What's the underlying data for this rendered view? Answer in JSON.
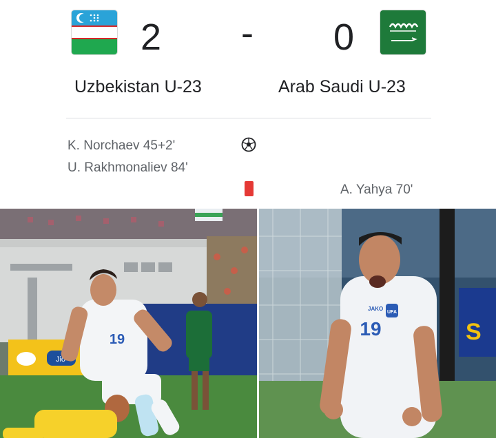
{
  "match": {
    "home": {
      "team": "Uzbekistan U-23",
      "score": "2",
      "flag_icon": "uzbekistan-flag-icon"
    },
    "away": {
      "team": "Arab Saudi U-23",
      "score": "0",
      "flag_icon": "saudi-arabia-flag-icon"
    },
    "separator": "-"
  },
  "events": {
    "goals_home": [
      "K. Norchaev 45+2'",
      "U. Rakhmonaliev 84'"
    ],
    "red_cards_away": [
      "A. Yahya 70'"
    ]
  },
  "icons": {
    "goal": "soccer-ball-icon",
    "red_card": "red-card-icon"
  },
  "colors": {
    "red_card": "#e53935",
    "uzb_blue": "#2aa3d8",
    "uzb_green": "#1fa84f",
    "ksa_green": "#1e7a3a"
  },
  "photos": {
    "left": {
      "jersey_number": "19",
      "ad_text": "Jio"
    },
    "right": {
      "jersey_number": "19",
      "brand": "JAKO",
      "badge": "UFA"
    }
  }
}
